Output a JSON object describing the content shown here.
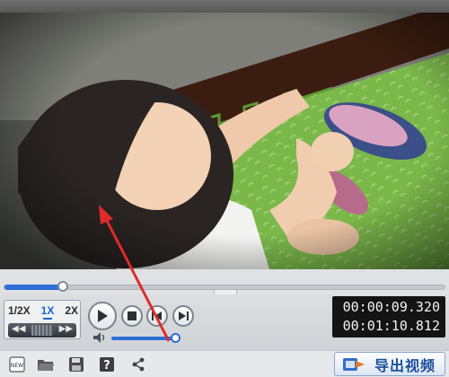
{
  "player": {
    "speed_options": [
      "1/2X",
      "1X",
      "2X"
    ],
    "active_speed": "1X",
    "jog": {
      "left": "◀◀",
      "right": "▶▶"
    },
    "current_time": "00:00:09.320",
    "total_time": "00:01:10.812",
    "seek_progress": 0.135,
    "volume_level": 0.95
  },
  "toolbar": {
    "export_label": "导出视频",
    "new_icon_text": "NEW"
  },
  "colors": {
    "accent": "#2e6fd6",
    "time_bg": "#141414",
    "annotation_arrow": "#e02a2a"
  },
  "icons": [
    "new-project-icon",
    "open-folder-icon",
    "save-icon",
    "help-icon",
    "share-icon",
    "export-video-icon",
    "volume-icon",
    "play-icon",
    "stop-icon",
    "previous-frame-icon",
    "next-frame-icon"
  ]
}
